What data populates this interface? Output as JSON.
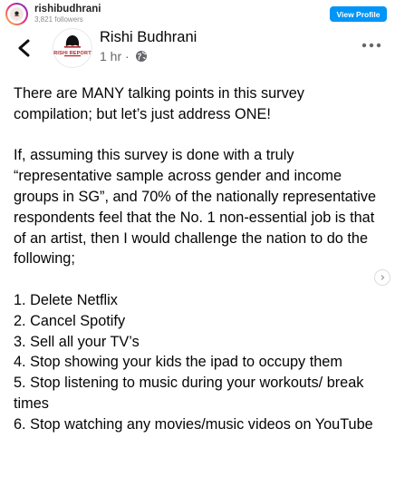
{
  "instagram": {
    "username": "rishibudhrani",
    "followers": "3,821 followers",
    "view_profile_label": "View Profile"
  },
  "post": {
    "author": "Rishi Budhrani",
    "logo_text": "RISHI REPORT",
    "time": "1 hr ·",
    "paragraphs": [
      "There are MANY talking points in this survey compilation; but let’s just address ONE!",
      "If, assuming this survey is done with a truly “representative sample across gender and income groups in SG”, and 70% of the nationally representative respondents feel that the No. 1 non-essential job is that of an artist, then I would challenge the nation to do the following;"
    ],
    "list": [
      "1. Delete Netflix",
      "2. Cancel Spotify",
      "3. Sell all your TV’s",
      "4. Stop showing your kids the ipad to occupy them",
      "5. Stop listening to music during your workouts/ break times",
      "6. Stop watching any movies/music videos on YouTube"
    ]
  },
  "icons": {
    "back": "chevron-left-icon",
    "privacy": "globe-icon",
    "more": "more-horizontal-icon",
    "carousel": "chevron-right-icon"
  },
  "colors": {
    "instagram_blue": "#0095f6",
    "text": "#050505",
    "meta_gray": "#65676b"
  }
}
